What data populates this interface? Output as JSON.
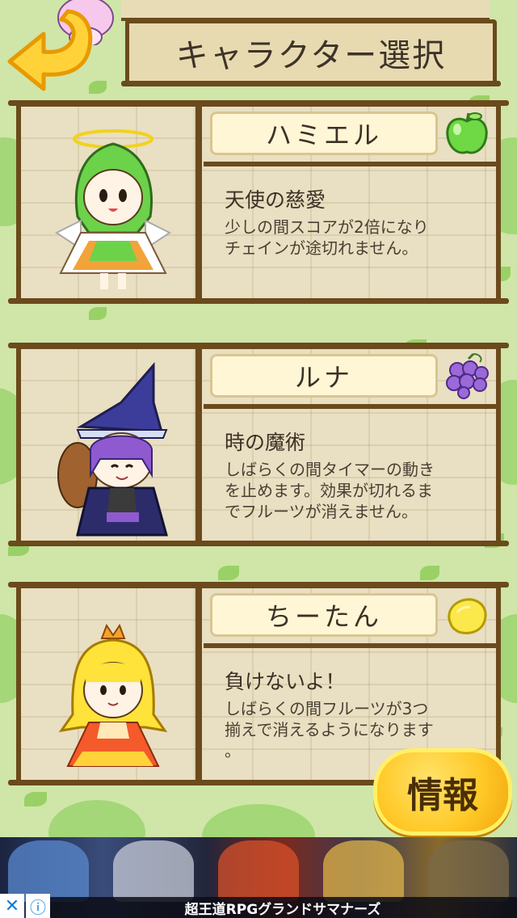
{
  "header": {
    "title": "キャラクター選択"
  },
  "characters": [
    {
      "name": "ハミエル",
      "skill_name": "天使の慈愛",
      "skill_desc": "少しの間スコアが2倍になり\nチェインが途切れません。",
      "fruit_icon": "green-apple-icon",
      "accent": "#5cc23a"
    },
    {
      "name": "ルナ",
      "skill_name": "時の魔術",
      "skill_desc": "しばらくの間タイマーの動き\nを止めます。効果が切れるま\nでフルーツが消えません。",
      "fruit_icon": "grape-icon",
      "accent": "#8a5fc8"
    },
    {
      "name": "ちーたん",
      "skill_name": "負けないよ！",
      "skill_desc": "しばらくの間フルーツが3つ\n揃えで消えるようになります\n。",
      "fruit_icon": "lemon-icon",
      "accent": "#f5dc3b"
    }
  ],
  "info_button": {
    "label": "情報"
  },
  "ad": {
    "caption": "超王道RPGグランドサマナーズ",
    "close_glyph": "✕",
    "info_glyph": "ⓘ"
  },
  "colors": {
    "wood": "#6b4a1c",
    "plank": "#e9dfc2",
    "background": "#cfe6a8",
    "button": "#ffc928"
  }
}
